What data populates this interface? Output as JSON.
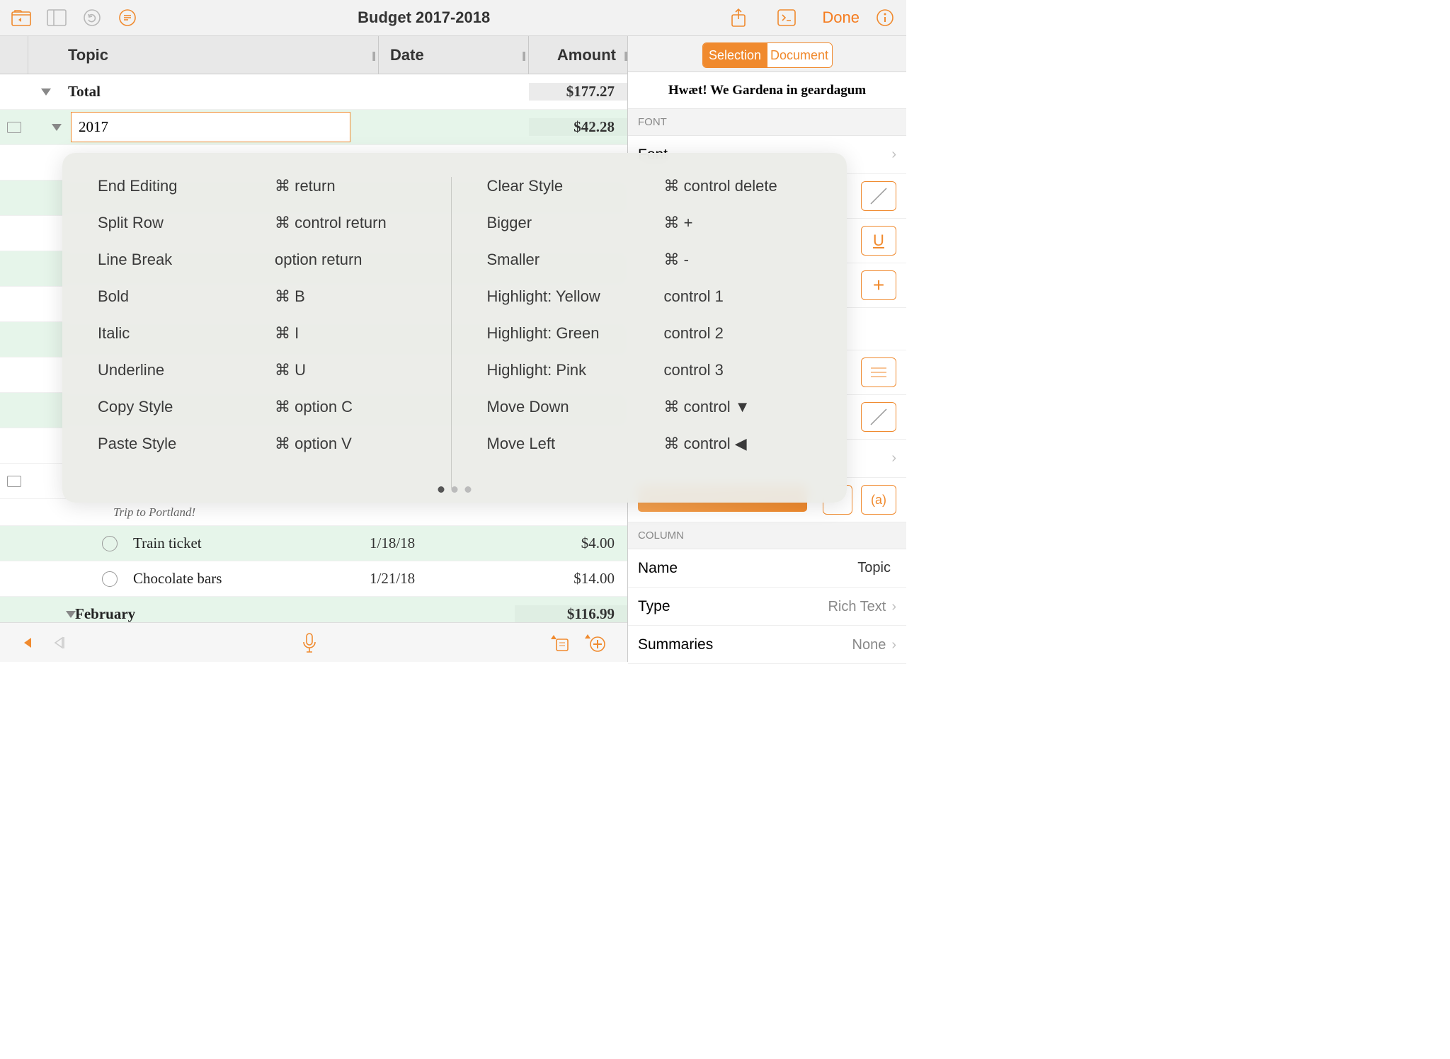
{
  "toolbar": {
    "title": "Budget 2017-2018",
    "done_label": "Done"
  },
  "columns": {
    "topic": "Topic",
    "date": "Date",
    "amount": "Amount"
  },
  "rows": {
    "total": {
      "label": "Total",
      "amount": "$177.27"
    },
    "year2017": {
      "label": "2017",
      "amount": "$42.28"
    },
    "note_portland": "Trip to Portland!",
    "train": {
      "label": "Train ticket",
      "date": "1/18/18",
      "amount": "$4.00"
    },
    "choco": {
      "label": "Chocolate bars",
      "date": "1/21/18",
      "amount": "$14.00"
    },
    "feb": {
      "label": "February",
      "amount": "$116.99"
    }
  },
  "inspector": {
    "seg_selection": "Selection",
    "seg_document": "Document",
    "preview": "Hwæt! We Gardena in geardagum",
    "section_font": "FONT",
    "font_label": "Font",
    "section_column": "COLUMN",
    "name_label": "Name",
    "name_value": "Topic",
    "type_label": "Type",
    "type_value": "Rich Text",
    "summaries_label": "Summaries",
    "summaries_value": "None",
    "badge_a": "(a)",
    "underline_u": "U"
  },
  "shortcuts": {
    "left": [
      {
        "label": "End Editing",
        "keys": "⌘  return"
      },
      {
        "label": "Split Row",
        "keys": "⌘  control return"
      },
      {
        "label": "Line Break",
        "keys": "option return"
      },
      {
        "label": "Bold",
        "keys": "⌘  B"
      },
      {
        "label": "Italic",
        "keys": "⌘  I"
      },
      {
        "label": "Underline",
        "keys": "⌘  U"
      },
      {
        "label": "Copy Style",
        "keys": "⌘  option C"
      },
      {
        "label": "Paste Style",
        "keys": "⌘  option V"
      }
    ],
    "right": [
      {
        "label": "Clear Style",
        "keys": "⌘  control delete"
      },
      {
        "label": "Bigger",
        "keys": "⌘  +"
      },
      {
        "label": "Smaller",
        "keys": "⌘  -"
      },
      {
        "label": "Highlight: Yellow",
        "keys": "control 1"
      },
      {
        "label": "Highlight: Green",
        "keys": "control 2"
      },
      {
        "label": "Highlight: Pink",
        "keys": "control 3"
      },
      {
        "label": "Move Down",
        "keys": "⌘  control ▼"
      },
      {
        "label": "Move Left",
        "keys": "⌘  control ◀"
      }
    ]
  }
}
